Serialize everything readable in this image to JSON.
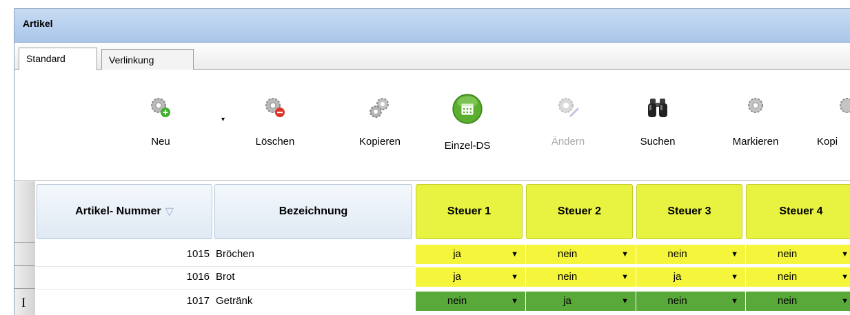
{
  "window": {
    "title": "Artikel"
  },
  "tabs": [
    {
      "label": "Standard",
      "active": true
    },
    {
      "label": "Verlinkung",
      "active": false
    }
  ],
  "toolbar": {
    "buttons": [
      {
        "label": "Neu",
        "icon": "gear-add-icon",
        "enabled": true
      },
      {
        "label": "Löschen",
        "icon": "gear-delete-icon",
        "enabled": true
      },
      {
        "label": "Kopieren",
        "icon": "gears-copy-icon",
        "enabled": true
      },
      {
        "label": "Einzel-DS",
        "icon": "calculator-icon",
        "enabled": true
      },
      {
        "label": "Ändern",
        "icon": "gear-edit-icon",
        "enabled": false
      },
      {
        "label": "Suchen",
        "icon": "binoculars-icon",
        "enabled": true
      },
      {
        "label": "Markieren",
        "icon": "gear-mark-icon",
        "enabled": true
      },
      {
        "label": "Kopi",
        "icon": "gear-icon",
        "enabled": true
      }
    ],
    "new_dropdown_arrow": "▾"
  },
  "grid": {
    "columns": [
      "Artikel- Nummer",
      "Bezeichnung",
      "Steuer 1",
      "Steuer 2",
      "Steuer 3",
      "Steuer 4"
    ],
    "sort_indicator": "▽",
    "rows": [
      {
        "nummer": "1015",
        "bezeichnung": "Bröchen",
        "steuer": [
          "ja",
          "nein",
          "nein",
          "nein"
        ],
        "color": "yellow"
      },
      {
        "nummer": "1016",
        "bezeichnung": "Brot",
        "steuer": [
          "ja",
          "nein",
          "ja",
          "nein"
        ],
        "color": "yellow"
      },
      {
        "nummer": "1017",
        "bezeichnung": "Getränk",
        "steuer": [
          "nein",
          "ja",
          "nein",
          "nein"
        ],
        "color": "green"
      }
    ],
    "dropdown_glyph": "▼",
    "text_cursor": "I"
  },
  "colors": {
    "steuer_header": "#e8f240",
    "row_yellow": "#f5f53b",
    "row_green": "#59a93a",
    "titlebar": "#a9c6ea"
  }
}
